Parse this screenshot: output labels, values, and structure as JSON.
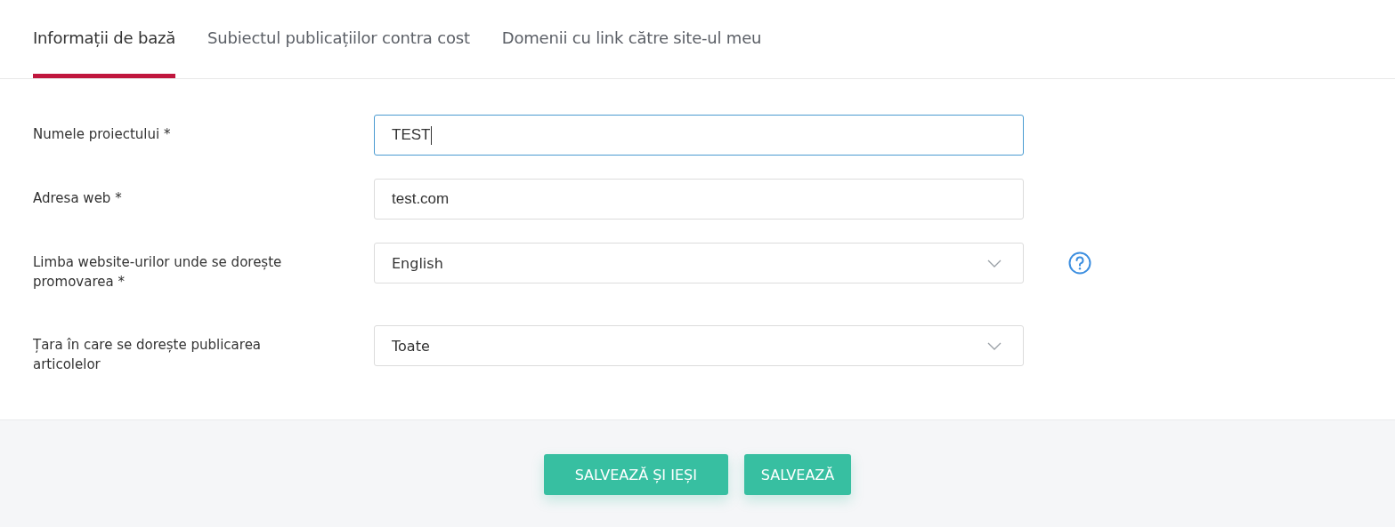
{
  "tabs": [
    {
      "label": "Informații de bază",
      "selected": true
    },
    {
      "label": "Subiectul publicațiilor contra cost",
      "selected": false
    },
    {
      "label": "Domenii cu link către site-ul meu",
      "selected": false
    }
  ],
  "fields": [
    {
      "kind": "text",
      "label": "Numele proiectului *",
      "value": "TEST",
      "focused": true,
      "help": false
    },
    {
      "kind": "text",
      "label": "Adresa web *",
      "value": "test.com",
      "focused": false,
      "help": false
    },
    {
      "kind": "select",
      "label": "Limba website-urilor unde se dorește promovarea *",
      "value": "English",
      "focused": false,
      "help": true
    },
    {
      "kind": "select",
      "label": "Țara în care se dorește publicarea articolelor",
      "value": "Toate",
      "focused": false,
      "help": false
    }
  ],
  "buttons": [
    "SALVEAZĂ ȘI IEȘI",
    "SALVEAZĂ"
  ]
}
